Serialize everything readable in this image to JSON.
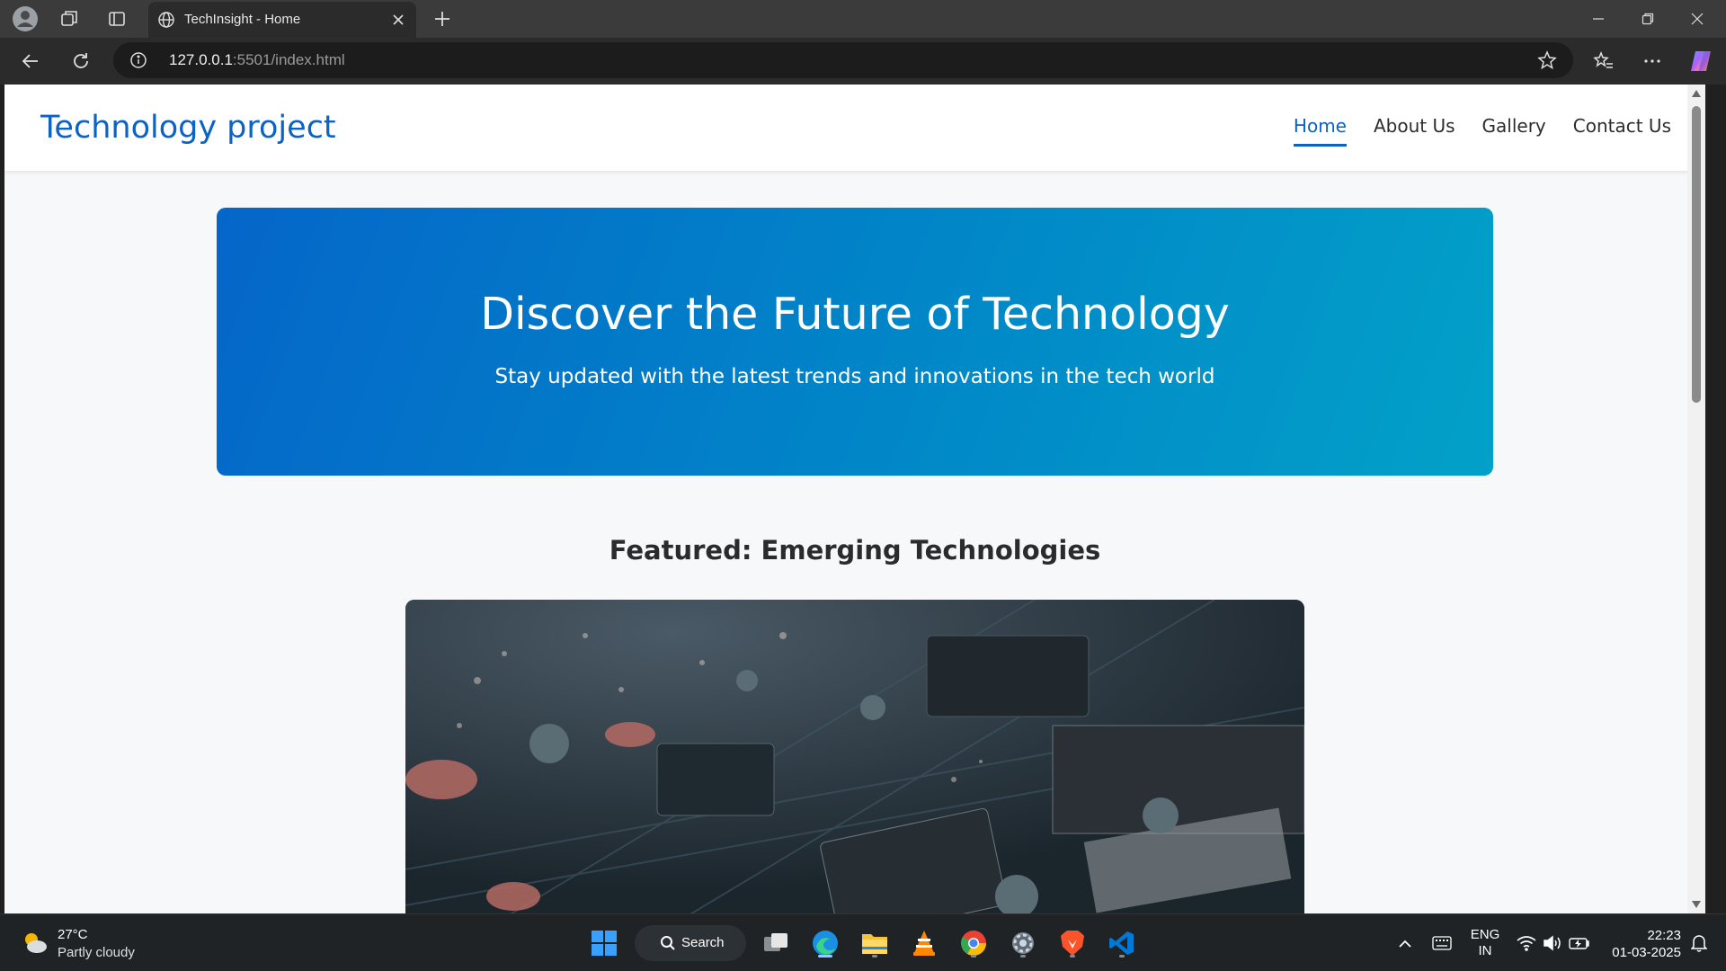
{
  "browser": {
    "tab_title": "TechInsight - Home",
    "url_host": "127.0.0.1",
    "url_rest": ":5501/index.html"
  },
  "site": {
    "brand": "Technology project",
    "nav": [
      "Home",
      "About Us",
      "Gallery",
      "Contact Us"
    ],
    "active_nav": "Home",
    "accent_color": "#0b63c5"
  },
  "hero": {
    "title": "Discover the Future of Technology",
    "subtitle": "Stay updated with the latest trends and innovations in the tech world",
    "gradient_start": "#0566c9",
    "gradient_end": "#02a1c8"
  },
  "featured": {
    "title": "Featured: Emerging Technologies",
    "image_icon": "circuit-board-photo"
  },
  "taskbar": {
    "weather_temp": "27°C",
    "weather_desc": "Partly cloudy",
    "search_label": "Search",
    "lang_1": "ENG",
    "lang_2": "IN",
    "time": "22:23",
    "date": "01-03-2025"
  }
}
